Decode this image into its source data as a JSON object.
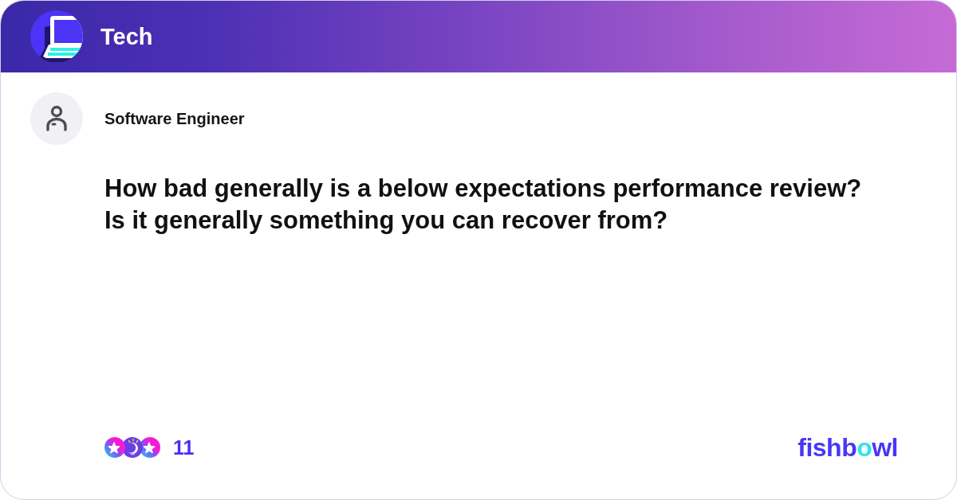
{
  "topic": {
    "title": "Tech"
  },
  "post": {
    "author": "Software Engineer",
    "question": "How bad generally is a below expectations performance review? Is it generally something you can recover from?"
  },
  "footer": {
    "reaction_count": "11",
    "logo": "fishbowl"
  }
}
